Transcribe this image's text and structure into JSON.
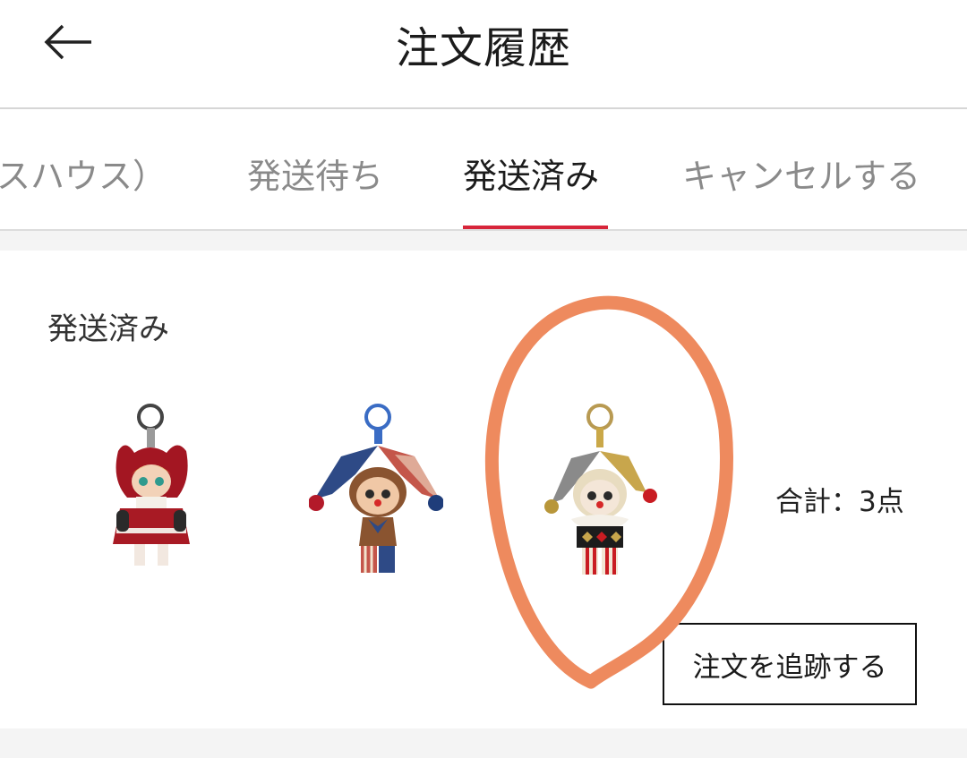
{
  "header": {
    "title": "注文履歴",
    "back_icon": "arrow-left-icon"
  },
  "tabs": [
    {
      "label": "スハウス）",
      "active": false
    },
    {
      "label": "発送待ち",
      "active": false
    },
    {
      "label": "発送済み",
      "active": true
    },
    {
      "label": "キャンセルする",
      "active": false
    }
  ],
  "order": {
    "status": "発送済み",
    "products": [
      {
        "name": "red-hooded-doll-keychain"
      },
      {
        "name": "jester-doll-keychain-blue-red"
      },
      {
        "name": "jester-clown-doll-keychain-gold"
      }
    ],
    "total": "合計：3点",
    "track_label": "注文を追跡する"
  },
  "colors": {
    "accent": "#d7253a",
    "highlight": "#ee8a5e"
  }
}
